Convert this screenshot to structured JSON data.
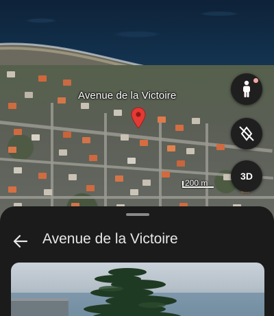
{
  "map": {
    "street_label": "Avenue de la Victoire",
    "scale_text": "200 m",
    "buttons": {
      "street_view_icon": "pegman-icon",
      "compass_icon": "compass-icon",
      "three_d_label": "3D"
    },
    "colors": {
      "pin": "#e53935",
      "button_bg": "#1f1f1f",
      "badge": "#f4a8a0"
    }
  },
  "sheet": {
    "title": "Avenue de la Victoire",
    "back_icon": "back-arrow-icon",
    "photo": "street-photo"
  }
}
